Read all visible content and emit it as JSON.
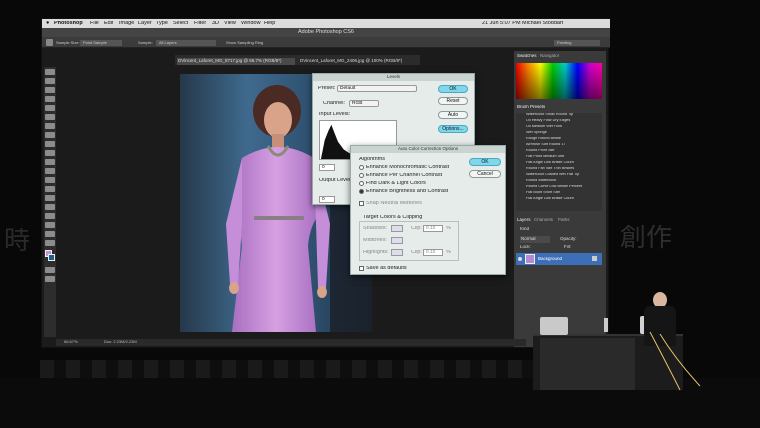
{
  "colors": {
    "screen_bg": "#1b1b1b",
    "photo_bg": "#2a3a4a",
    "dress": "#c98fd6",
    "dialog_bg": "#e6ecea",
    "default_button": "#7fd7ec",
    "menubar": "#dcdcdc"
  },
  "menubar": {
    "apple": "",
    "app": "Photoshop",
    "items": [
      "File",
      "Edit",
      "Image",
      "Layer",
      "Type",
      "Select",
      "Filter",
      "3D",
      "View",
      "Window",
      "Help"
    ],
    "right_status": "21 Jun  5:07 PM  Michael Stoddart"
  },
  "window_title": "Adobe Photoshop CS6",
  "options_bar": {
    "sample_size_label": "Sample Size:",
    "sample_size_value": "Point Sample",
    "sample_label": "Sample:",
    "sample_value": "All Layers",
    "show_ring": "Show Sampling Ring",
    "workspace": "Painting"
  },
  "doc_tabs": [
    "DVincent_Laforet_MG_8717.jpg @ 66.7% (RGB/8*)",
    "DVincent_Laforet_MG_2406.jpg @ 100% (RGB/8*)"
  ],
  "status_bar": {
    "zoom": "66.67%",
    "doc": "Doc: 2.23M/2.23M"
  },
  "levels": {
    "title": "Levels",
    "preset_label": "Preset:",
    "preset_value": "Default",
    "channel_label": "Channel:",
    "channel_value": "RGB",
    "input_levels_label": "Input Levels:",
    "input_min": "0",
    "output_levels_label": "Output Levels:",
    "output_min": "0",
    "ok": "OK",
    "reset": "Reset",
    "auto": "Auto",
    "options": "Options..."
  },
  "autocolor": {
    "title": "Auto Color Correction Options",
    "algorithms_label": "Algorithms",
    "algos": [
      {
        "label": "Enhance Monochromatic Contrast",
        "selected": false
      },
      {
        "label": "Enhance Per Channel Contrast",
        "selected": false
      },
      {
        "label": "Find Dark & Light Colors",
        "selected": false
      },
      {
        "label": "Enhance Brightness and Contrast",
        "selected": true
      }
    ],
    "snap_label": "Snap Neutral Midtones",
    "target_label": "Target Colors & Clipping",
    "targets": [
      {
        "name": "Shadows:",
        "clip_label": "Clip:",
        "clip": "0.10",
        "pct": "%"
      },
      {
        "name": "Midtones:",
        "clip_label": "",
        "clip": "",
        "pct": ""
      },
      {
        "name": "Highlights:",
        "clip_label": "Clip:",
        "clip": "0.10",
        "pct": "%"
      }
    ],
    "save_default": "Save as defaults",
    "ok": "OK",
    "cancel": "Cancel"
  },
  "panels": {
    "swatch_tabs": [
      "Swatches",
      "Navigator"
    ],
    "brush_presets_title": "Brush Presets",
    "brushes": [
      "Watercolor Small Round Tip",
      "Oil Heavy Flow Dry Edges",
      "Oil Medium Wet Flow",
      "Wet Sponge",
      "Rough Round Bristle",
      "Airbrush Soft Round 17",
      "Round Point Stiff",
      "Flat Point Medium Stiff",
      "Flat Angle Low Bristle Count",
      "Round Fan Stiff Thin Bristles",
      "Watercolor Loaded Wet Flat Tip",
      "Round Watercolor",
      "Round Curve Low Bristle Percent",
      "Flat Blunt Short Stiff",
      "Flat Angle Low Bristle Count"
    ],
    "layers_tabs": [
      "Layers",
      "Channels",
      "Paths"
    ],
    "kind_label": "Kind",
    "blend_mode": "Normal",
    "opacity_label": "Opacity:",
    "lock_label": "Lock:",
    "fill_label": "Fill:",
    "layer_name": "Background"
  },
  "backdrop": {
    "left_chars": "時",
    "right_chars": "創作"
  }
}
